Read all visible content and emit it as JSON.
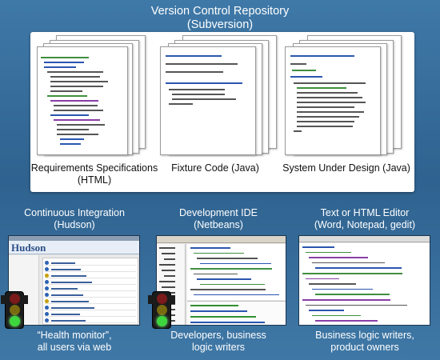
{
  "repository": {
    "title": "Version Control Repository",
    "subtitle": "(Subversion)",
    "documents": [
      {
        "label_line1": "Requirements Specifications",
        "label_line2": "(HTML)",
        "doc_type": "html"
      },
      {
        "label_line1": "Fixture Code (Java)",
        "label_line2": "",
        "doc_type": "java"
      },
      {
        "label_line1": "System Under Design (Java)",
        "label_line2": "",
        "doc_type": "java"
      }
    ]
  },
  "tools": [
    {
      "title_line1": "Continuous Integration",
      "title_line2": "(Hudson)",
      "screenshot_brand": "Hudson",
      "caption_line1": "“Health monitor”,",
      "caption_line2": "all users via web",
      "has_traffic_light": true
    },
    {
      "title_line1": "Development IDE",
      "title_line2": "(Netbeans)",
      "caption_line1": "Developers, business",
      "caption_line2": "logic writers",
      "has_traffic_light": true
    },
    {
      "title_line1": "Text or HTML Editor",
      "title_line2": "(Word, Notepad, gedit)",
      "caption_line1": "Business logic writers,",
      "caption_line2": "product owners",
      "has_traffic_light": false
    }
  ],
  "colors": {
    "background": "#3a6f9e",
    "code_green": "#3f8f3f",
    "code_blue": "#2a55b0",
    "code_purple": "#8a3ea6",
    "light_red": "#7a1a1a",
    "light_yellow": "#7a6a10",
    "light_green": "#3ed63e"
  },
  "icons": [
    "traffic-light-icon"
  ]
}
